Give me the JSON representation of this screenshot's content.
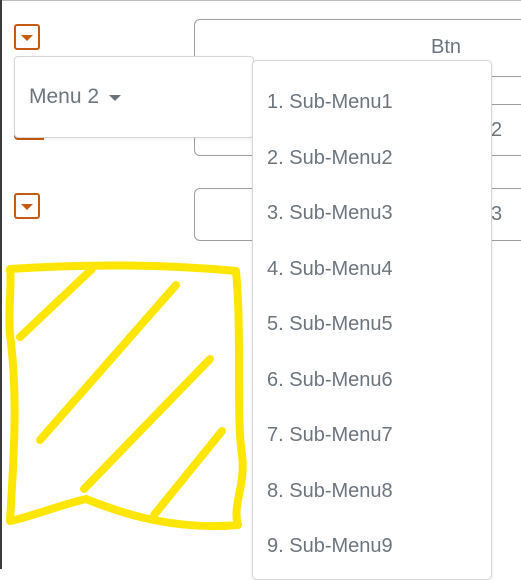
{
  "buttons": [
    {
      "label": "Btn"
    },
    {
      "label": "2"
    },
    {
      "label": "3"
    }
  ],
  "menu": {
    "label": "Menu 2"
  },
  "submenu": {
    "items": [
      "1. Sub-Menu1",
      "2. Sub-Menu2",
      "3. Sub-Menu3",
      "4. Sub-Menu4",
      "5. Sub-Menu5",
      "6. Sub-Menu6",
      "7. Sub-Menu7",
      "8. Sub-Menu8",
      "9. Sub-Menu9"
    ]
  },
  "icons": {
    "toggle": "caret-down-icon",
    "menu_caret": "caret-down-icon"
  },
  "colors": {
    "accent": "#c55a11",
    "text": "#6c757d",
    "highlight": "#ffe600"
  }
}
